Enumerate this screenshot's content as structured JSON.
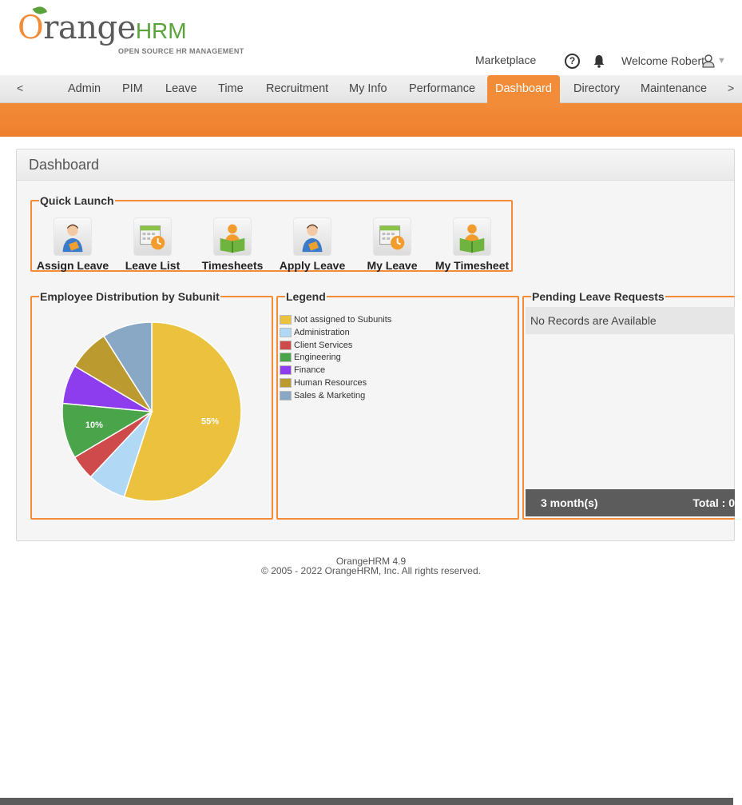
{
  "header": {
    "logo_orange": "range",
    "logo_hrm": "HRM",
    "logo_tagline": "OPEN SOURCE HR MANAGEMENT",
    "marketplace": "Marketplace",
    "help_label": "?",
    "welcome": "Welcome Robert",
    "icons": [
      "help-icon",
      "bell-icon",
      "user-icon",
      "chevron-down-icon"
    ]
  },
  "menu": {
    "prev": "<",
    "next": ">",
    "items": [
      {
        "label": "Admin"
      },
      {
        "label": "PIM"
      },
      {
        "label": "Leave"
      },
      {
        "label": "Time"
      },
      {
        "label": "Recruitment"
      },
      {
        "label": "My Info"
      },
      {
        "label": "Performance"
      },
      {
        "label": "Dashboard",
        "active": true
      },
      {
        "label": "Directory"
      },
      {
        "label": "Maintenance"
      }
    ]
  },
  "dashboard": {
    "title": "Dashboard",
    "quick_launch": {
      "title": "Quick Launch",
      "items": [
        {
          "label": "Assign Leave",
          "icon": "assign-leave-icon"
        },
        {
          "label": "Leave List",
          "icon": "leave-list-icon"
        },
        {
          "label": "Timesheets",
          "icon": "timesheets-icon"
        },
        {
          "label": "Apply Leave",
          "icon": "apply-leave-icon"
        },
        {
          "label": "My Leave",
          "icon": "my-leave-icon"
        },
        {
          "label": "My Timesheet",
          "icon": "my-timesheet-icon"
        }
      ]
    },
    "distribution": {
      "title": "Employee Distribution by Subunit"
    },
    "legend": {
      "title": "Legend"
    },
    "pending": {
      "title": "Pending Leave Requests",
      "empty": "No Records are Available",
      "period": "3 month(s)",
      "total": "Total : 0"
    }
  },
  "chart_data": {
    "type": "pie",
    "slices": [
      {
        "label": "Not assigned to Subunits",
        "value": 55,
        "color": "#ebc13d",
        "display": "55%"
      },
      {
        "label": "Administration",
        "value": 7,
        "color": "#b1d8f5",
        "display": ""
      },
      {
        "label": "Client Services",
        "value": 4.5,
        "color": "#cf4a4a",
        "display": ""
      },
      {
        "label": "Engineering",
        "value": 10,
        "color": "#4aa54a",
        "display": "10%"
      },
      {
        "label": "Finance",
        "value": 7,
        "color": "#8d3ded",
        "display": ""
      },
      {
        "label": "Human Resources",
        "value": 7.5,
        "color": "#bb9a2f",
        "display": ""
      },
      {
        "label": "Sales & Marketing",
        "value": 9,
        "color": "#88a8c6",
        "display": ""
      }
    ]
  },
  "footer": {
    "version": "OrangeHRM 4.9",
    "copyright": "© 2005 - 2022 OrangeHRM, Inc. All rights reserved."
  }
}
